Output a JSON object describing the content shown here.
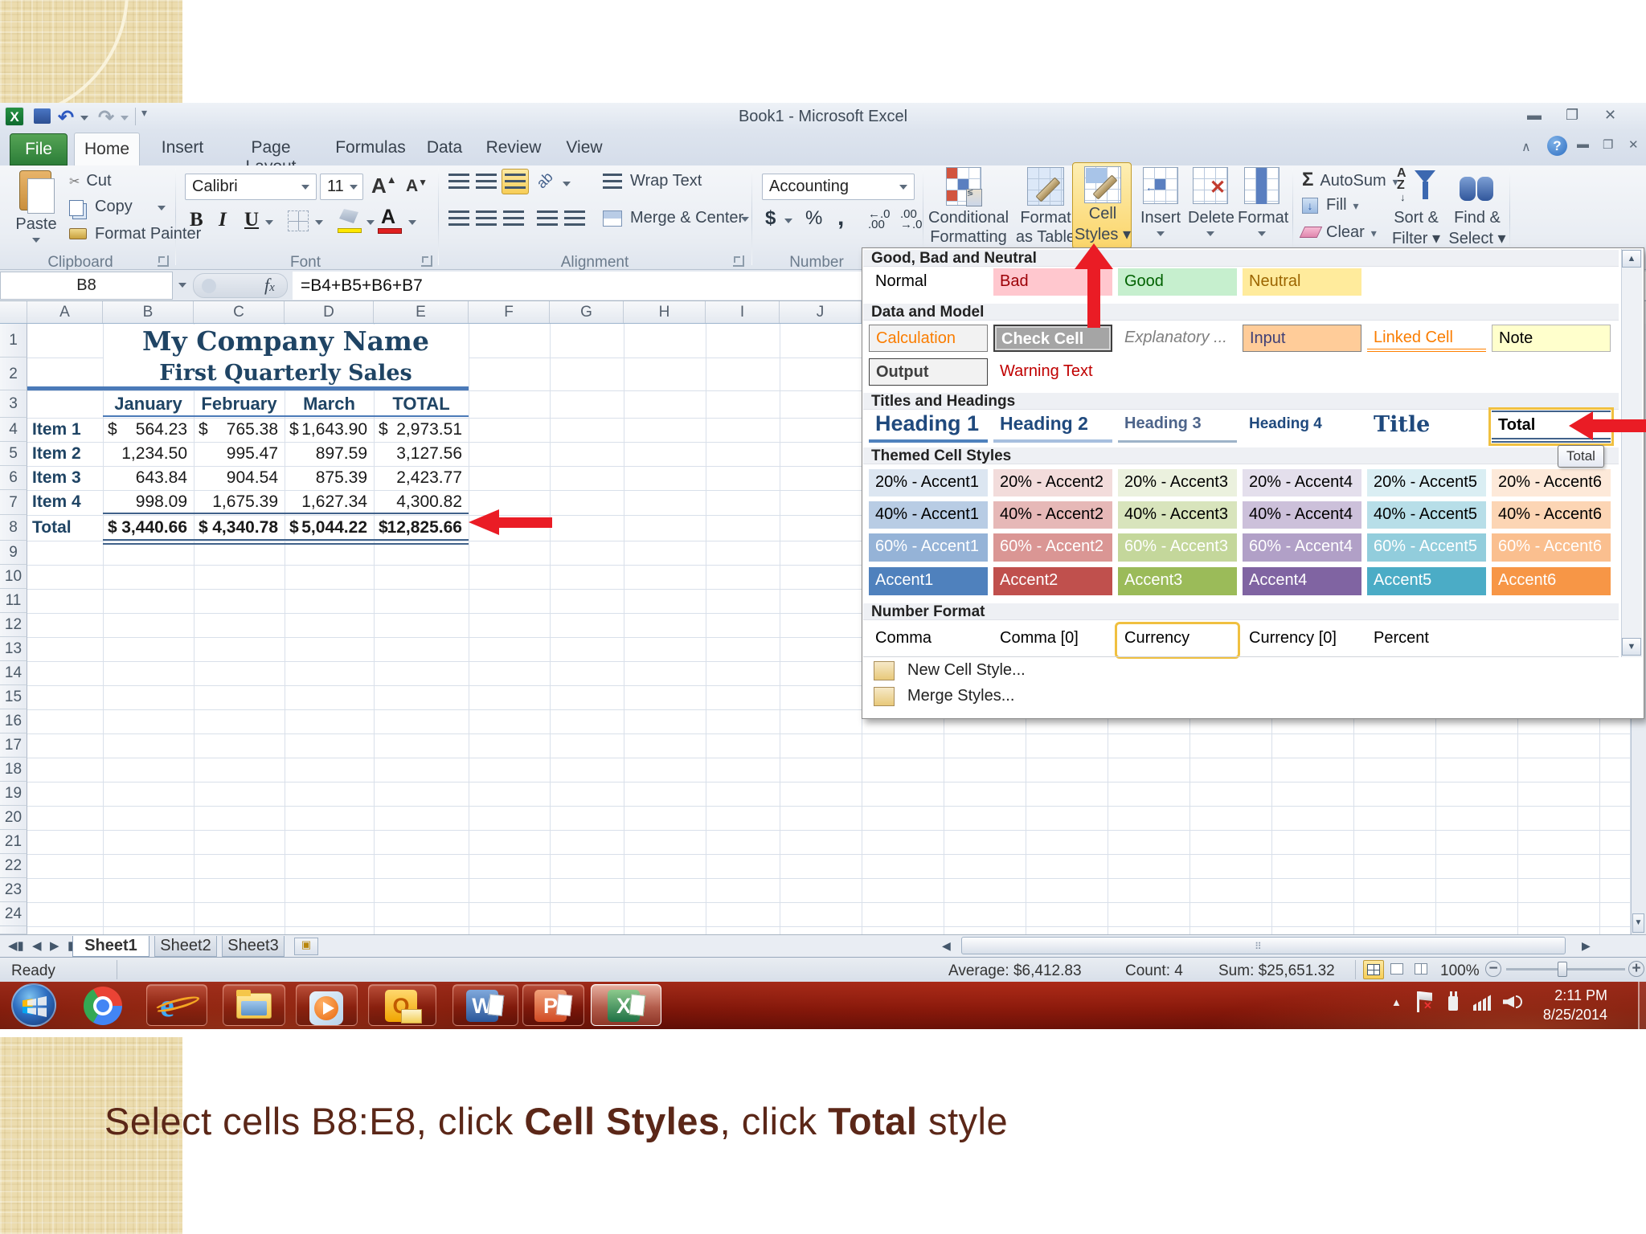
{
  "window": {
    "title": "Book1 - Microsoft Excel",
    "tabs": [
      "File",
      "Home",
      "Insert",
      "Page Layout",
      "Formulas",
      "Data",
      "Review",
      "View"
    ],
    "ribbon": {
      "clipboard": {
        "label": "Clipboard",
        "paste": "Paste",
        "cut": "Cut",
        "copy": "Copy",
        "format_painter": "Format Painter"
      },
      "font": {
        "label": "Font",
        "family": "Calibri",
        "size": "11"
      },
      "alignment": {
        "label": "Alignment",
        "wrap": "Wrap Text",
        "merge": "Merge & Center"
      },
      "number": {
        "label": "Number",
        "format": "Accounting"
      },
      "styles": {
        "cond1": "Conditional",
        "cond2": "Formatting",
        "fat1": "Format",
        "fat2": "as Table",
        "cs1": "Cell",
        "cs2": "Styles"
      },
      "cells": {
        "insert": "Insert",
        "del": "Delete",
        "format": "Format"
      },
      "editing": {
        "autosum": "AutoSum",
        "fill": "Fill",
        "clear": "Clear",
        "sort1": "Sort &",
        "sort2": "Filter",
        "find1": "Find &",
        "find2": "Select"
      }
    },
    "formula_bar": {
      "name_box": "B8",
      "formula": "=B4+B5+B6+B7"
    },
    "sheet": {
      "col_headers": [
        "A",
        "B",
        "C",
        "D",
        "E",
        "F",
        "G",
        "H",
        "I",
        "J"
      ],
      "table": {
        "title": "My Company Name",
        "subtitle": "First Quarterly Sales",
        "months": [
          "January",
          "February",
          "March",
          "TOTAL"
        ],
        "rows": [
          {
            "label": "Item 1",
            "currency": true,
            "vals": [
              "564.23",
              "765.38",
              "1,643.90",
              "2,973.51"
            ]
          },
          {
            "label": "Item 2",
            "currency": false,
            "vals": [
              "1,234.50",
              "995.47",
              "897.59",
              "3,127.56"
            ]
          },
          {
            "label": "Item 3",
            "currency": false,
            "vals": [
              "643.84",
              "904.54",
              "875.39",
              "2,423.77"
            ]
          },
          {
            "label": "Item 4",
            "currency": false,
            "vals": [
              "998.09",
              "1,675.39",
              "1,627.34",
              "4,300.82"
            ]
          },
          {
            "label": "Total",
            "currency": true,
            "bold": true,
            "vals": [
              "3,440.66",
              "4,340.78",
              "5,044.22",
              "12,825.66"
            ]
          }
        ]
      }
    },
    "gallery": {
      "sections": [
        {
          "header": "Good, Bad and Neutral",
          "rows": [
            [
              {
                "label": "Normal",
                "style": "normal"
              },
              {
                "label": "Bad",
                "style": "bad"
              },
              {
                "label": "Good",
                "style": "good"
              },
              {
                "label": "Neutral",
                "style": "neutral"
              }
            ]
          ]
        },
        {
          "header": "Data and Model",
          "rows": [
            [
              {
                "label": "Calculation",
                "style": "calculation"
              },
              {
                "label": "Check Cell",
                "style": "checkcell"
              },
              {
                "label": "Explanatory ...",
                "style": "explanatory"
              },
              {
                "label": "Input",
                "style": "input"
              },
              {
                "label": "Linked Cell",
                "style": "linkedcell"
              },
              {
                "label": "Note",
                "style": "note"
              }
            ],
            [
              {
                "label": "Output",
                "style": "output"
              },
              {
                "label": "Warning Text",
                "style": "warningtext"
              }
            ]
          ]
        },
        {
          "header": "Titles and Headings",
          "rows": [
            [
              {
                "label": "Heading 1",
                "style": "heading1"
              },
              {
                "label": "Heading 2",
                "style": "heading2"
              },
              {
                "label": "Heading 3",
                "style": "heading3"
              },
              {
                "label": "Heading 4",
                "style": "heading4"
              },
              {
                "label": "Title",
                "style": "titlestyle"
              },
              {
                "label": "Total",
                "style": "totalstyle hovered"
              }
            ]
          ]
        },
        {
          "header": "Themed Cell Styles",
          "rows": [
            [
              {
                "label": "20% - Accent1",
                "style": "p20a1"
              },
              {
                "label": "20% - Accent2",
                "style": "p20a2"
              },
              {
                "label": "20% - Accent3",
                "style": "p20a3"
              },
              {
                "label": "20% - Accent4",
                "style": "p20a4"
              },
              {
                "label": "20% - Accent5",
                "style": "p20a5"
              },
              {
                "label": "20% - Accent6",
                "style": "p20a6"
              }
            ],
            [
              {
                "label": "40% - Accent1",
                "style": "p40a1"
              },
              {
                "label": "40% - Accent2",
                "style": "p40a2"
              },
              {
                "label": "40% - Accent3",
                "style": "p40a3"
              },
              {
                "label": "40% - Accent4",
                "style": "p40a4"
              },
              {
                "label": "40% - Accent5",
                "style": "p40a5"
              },
              {
                "label": "40% - Accent6",
                "style": "p40a6"
              }
            ],
            [
              {
                "label": "60% - Accent1",
                "style": "p60a1"
              },
              {
                "label": "60% - Accent2",
                "style": "p60a2"
              },
              {
                "label": "60% - Accent3",
                "style": "p60a3"
              },
              {
                "label": "60% - Accent4",
                "style": "p60a4"
              },
              {
                "label": "60% - Accent5",
                "style": "p60a5"
              },
              {
                "label": "60% - Accent6",
                "style": "p60a6"
              }
            ],
            [
              {
                "label": "Accent1",
                "style": "pa1"
              },
              {
                "label": "Accent2",
                "style": "pa2"
              },
              {
                "label": "Accent3",
                "style": "pa3"
              },
              {
                "label": "Accent4",
                "style": "pa4"
              },
              {
                "label": "Accent5",
                "style": "pa5"
              },
              {
                "label": "Accent6",
                "style": "pa6"
              }
            ]
          ]
        },
        {
          "header": "Number Format",
          "rows": [
            [
              {
                "label": "Comma",
                "style": "plainnf"
              },
              {
                "label": "Comma [0]",
                "style": "plainnf"
              },
              {
                "label": "Currency",
                "style": "plainnf hovered2"
              },
              {
                "label": "Currency [0]",
                "style": "plainnf"
              },
              {
                "label": "Percent",
                "style": "plainnf"
              }
            ]
          ]
        }
      ],
      "menu": [
        {
          "label": "New Cell Style...",
          "icon": "new-cell-style-icon"
        },
        {
          "label": "Merge Styles...",
          "icon": "merge-styles-icon"
        }
      ],
      "tooltip": "Total"
    },
    "sheet_tabs": [
      "Sheet1",
      "Sheet2",
      "Sheet3"
    ],
    "status": {
      "ready": "Ready",
      "average": "Average: $6,412.83",
      "count": "Count: 4",
      "sum": "Sum: $25,651.32",
      "zoom": "100%"
    }
  },
  "taskbar": {
    "time": "2:11 PM",
    "date": "8/25/2014"
  },
  "caption": {
    "parts": [
      {
        "t": "Select cells B8:E8, click ",
        "b": false
      },
      {
        "t": "Cell Styles",
        "b": true
      },
      {
        "t": ", click ",
        "b": false
      },
      {
        "t": "Total",
        "b": true
      },
      {
        "t": " style",
        "b": false
      }
    ]
  }
}
